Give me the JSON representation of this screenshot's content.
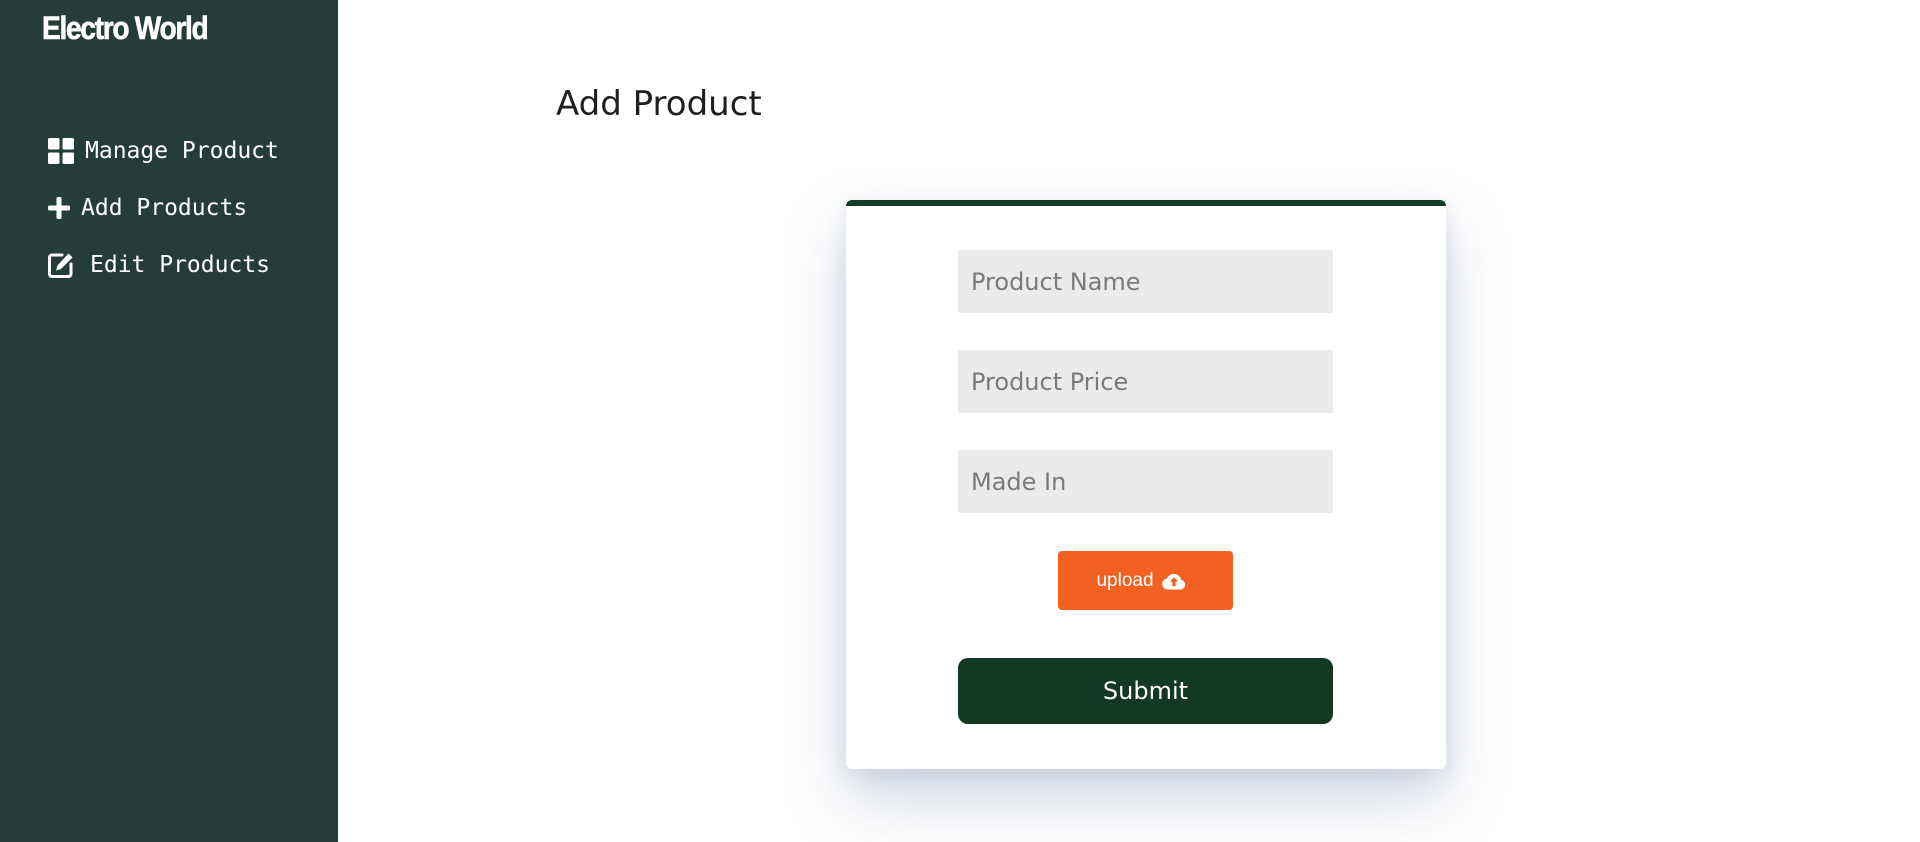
{
  "sidebar": {
    "brand": "Electro World",
    "items": [
      {
        "label": "Manage Product",
        "icon": "grid-icon"
      },
      {
        "label": "Add Products",
        "icon": "plus-icon"
      },
      {
        "label": "Edit Products",
        "icon": "edit-icon"
      }
    ]
  },
  "main": {
    "title": "Add Product",
    "form": {
      "product_name_placeholder": "Product Name",
      "product_price_placeholder": "Product Price",
      "made_in_placeholder": "Made In",
      "upload_label": "upload",
      "upload_icon": "cloud-upload-icon",
      "submit_label": "Submit"
    }
  },
  "colors": {
    "sidebar_bg": "#243d38",
    "card_accent": "#133b25",
    "upload_button": "#f26122",
    "submit_button": "#133823",
    "input_bg": "#ebebeb"
  }
}
